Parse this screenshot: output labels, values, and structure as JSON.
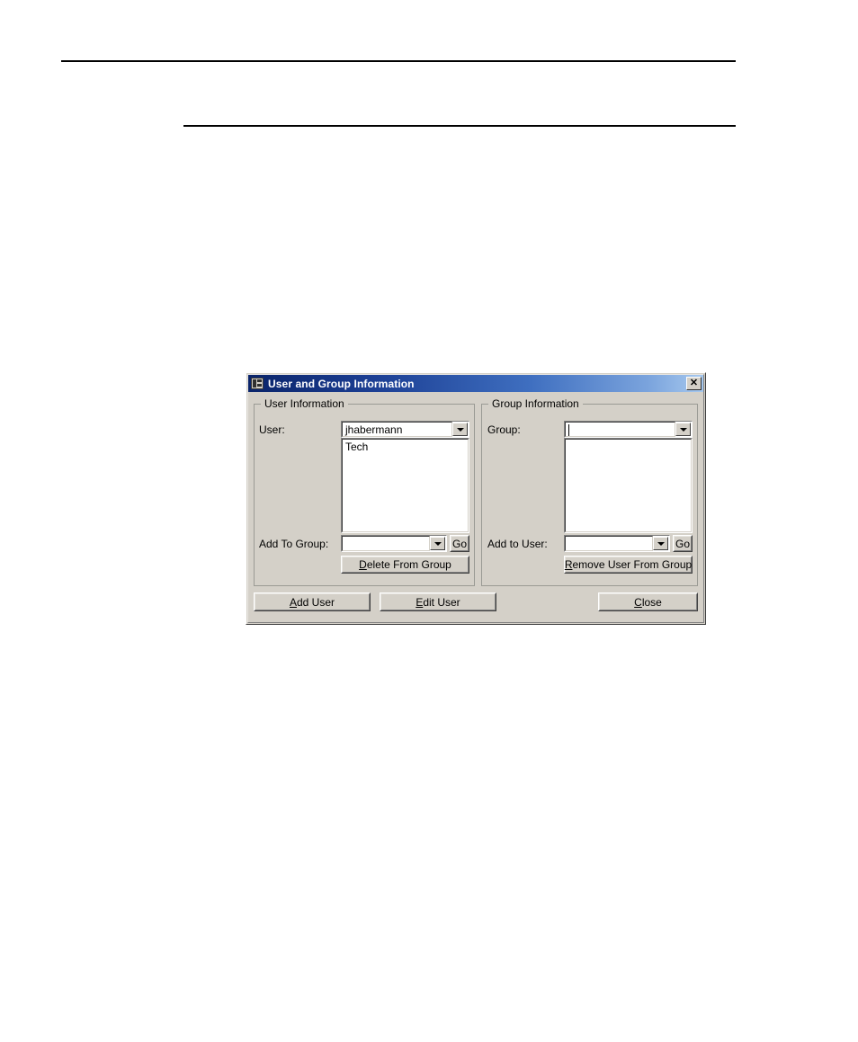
{
  "page": {
    "rules": [
      "top-rule",
      "second-rule"
    ]
  },
  "dialog": {
    "title": "User and Group Information",
    "title_icon": "window-grid-icon",
    "close_label": "✕",
    "accent_color": "#0a246a",
    "face_color": "#d4d0c8",
    "user_panel": {
      "legend": "User Information",
      "user_label": "User:",
      "user_value": "jhabermann",
      "user_placeholder": "",
      "groups_list": [
        "Tech"
      ],
      "add_to_group_label": "Add To Group:",
      "add_to_group_value": "",
      "add_to_group_placeholder": "",
      "go_label": "Go",
      "delete_from_group": {
        "accel": "D",
        "rest": "elete From Group"
      }
    },
    "group_panel": {
      "legend": "Group Information",
      "group_label": "Group:",
      "group_value": "",
      "group_placeholder": "",
      "members_list": [],
      "add_to_user_label": "Add to User:",
      "add_to_user_value": "",
      "add_to_user_placeholder": "",
      "go_label": "Go",
      "remove_user_from_group": {
        "accel": "R",
        "rest": "emove User From Group"
      }
    },
    "footer": {
      "add_user": {
        "accel": "A",
        "rest": "dd User"
      },
      "edit_user": {
        "accel": "E",
        "rest": "dit User"
      },
      "close": {
        "accel": "C",
        "rest": "lose"
      }
    }
  }
}
